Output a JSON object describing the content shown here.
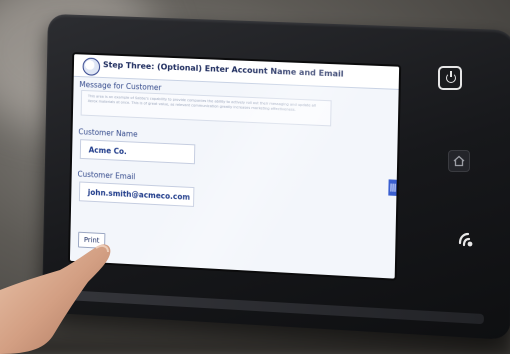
{
  "screen": {
    "title": "Step Three: (Optional) Enter Account Name and Email",
    "message_label": "Message for Customer",
    "message_text": "This area is an example of Sabbe's capability to provide companies the ability to actively roll out their messaging and update all Xerox materials at once. This is of great value, as relevant communication greatly increases marketing effectiveness.",
    "customer_name_label": "Customer Name",
    "customer_name_value": "Acme Co.",
    "customer_email_label": "Customer Email",
    "customer_email_value": "john.smith@acmeco.com",
    "print_label": "Print"
  },
  "icons": {
    "logo": "company-logo-icon",
    "power": "power-icon",
    "home": "home-icon",
    "nfc": "nfc-icon",
    "scroll": "scroll-grip-icon"
  },
  "colors": {
    "title": "#1d2b5e",
    "label": "#344a8c",
    "value": "#1e3a8a",
    "accent": "#3a5fd0",
    "bezel": "#17181b"
  }
}
